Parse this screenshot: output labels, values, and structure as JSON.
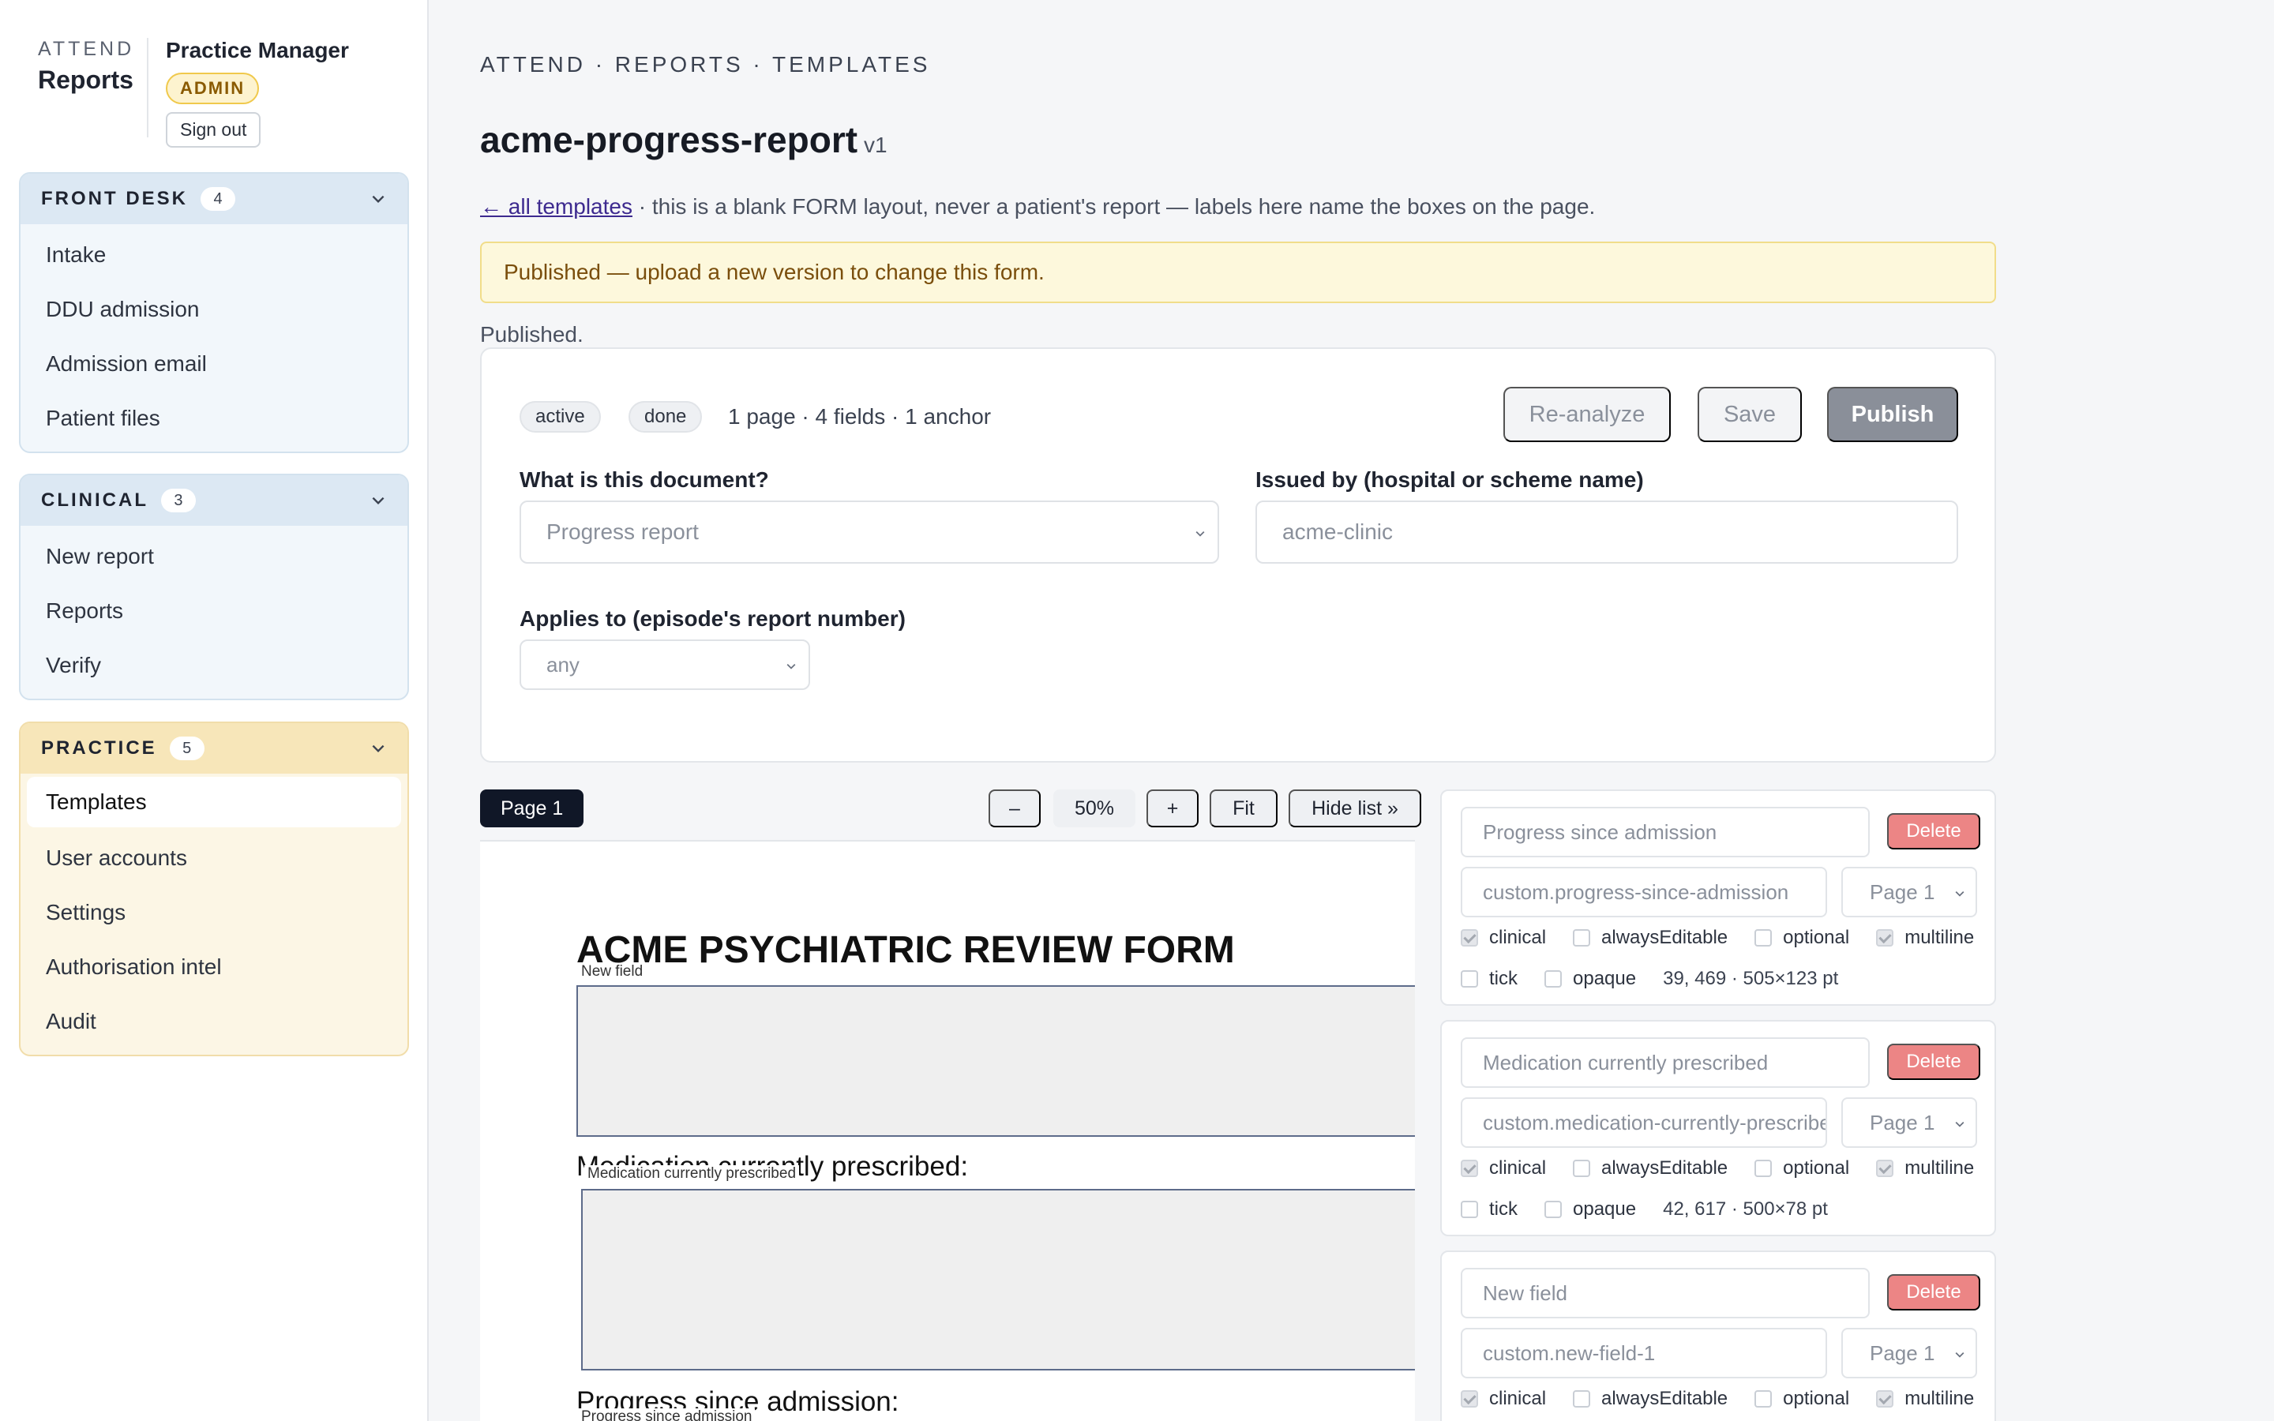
{
  "brand": {
    "small": "ATTEND",
    "big": "Reports"
  },
  "user": {
    "name": "Practice Manager",
    "role": "ADMIN",
    "signout": "Sign out"
  },
  "nav": [
    {
      "title": "FRONT DESK",
      "count": "4",
      "items": [
        "Intake",
        "DDU admission",
        "Admission email",
        "Patient files"
      ]
    },
    {
      "title": "CLINICAL",
      "count": "3",
      "items": [
        "New report",
        "Reports",
        "Verify"
      ]
    },
    {
      "title": "PRACTICE",
      "count": "5",
      "items": [
        "Templates",
        "User accounts",
        "Settings",
        "Authorisation intel",
        "Audit"
      ],
      "active": "Templates"
    }
  ],
  "breadcrumb": "ATTEND · REPORTS · TEMPLATES",
  "page_title": "acme-progress-report",
  "version": "v1",
  "back_link": "← all templates",
  "subline": " · this is a blank FORM layout, never a patient's report — labels here name the boxes on the page.",
  "notice": "Published — upload a new version to change this form.",
  "status_text": "Published.",
  "card": {
    "chips": [
      "active",
      "done"
    ],
    "meta": "1 page · 4 fields · 1 anchor",
    "buttons": {
      "reanalyze": "Re-analyze",
      "save": "Save",
      "publish": "Publish"
    },
    "doc_type_label": "What is this document?",
    "doc_type_value": "Progress report",
    "issuer_label": "Issued by (hospital or scheme name)",
    "issuer_value": "acme-clinic",
    "applies_label": "Applies to (episode's report number)",
    "applies_value": "any"
  },
  "viewer": {
    "page_tab": "Page 1",
    "zoom_out": "–",
    "zoom": "50%",
    "zoom_in": "+",
    "fit": "Fit",
    "hide_list": "Hide list »"
  },
  "doc": {
    "title": "ACME PSYCHIATRIC REVIEW FORM",
    "tag1": "New field",
    "text2": "Medication currently prescribed:",
    "tag2": "Medication currently prescribed",
    "text3": "Progress since admission:",
    "tag3": "Progress since admission"
  },
  "fields": [
    {
      "label": "Progress since admission",
      "key": "custom.progress-since-admission",
      "page": "Page 1",
      "delete": "Delete",
      "checks": {
        "clinical": true,
        "alwaysEditable": false,
        "optional": false,
        "multiline": true,
        "tick": false,
        "opaque": false
      },
      "geometry": "39, 469 · 505×123 pt"
    },
    {
      "label": "Medication currently prescribed",
      "key": "custom.medication-currently-prescribed",
      "page": "Page 1",
      "delete": "Delete",
      "checks": {
        "clinical": true,
        "alwaysEditable": false,
        "optional": false,
        "multiline": true,
        "tick": false,
        "opaque": false
      },
      "geometry": "42, 617 · 500×78 pt"
    },
    {
      "label": "New field",
      "key": "custom.new-field-1",
      "page": "Page 1",
      "delete": "Delete",
      "checks": {
        "clinical": true,
        "alwaysEditable": false,
        "optional": false,
        "multiline": true
      }
    }
  ],
  "check_labels": {
    "clinical": "clinical",
    "alwaysEditable": "alwaysEditable",
    "optional": "optional",
    "multiline": "multiline",
    "tick": "tick",
    "opaque": "opaque"
  }
}
